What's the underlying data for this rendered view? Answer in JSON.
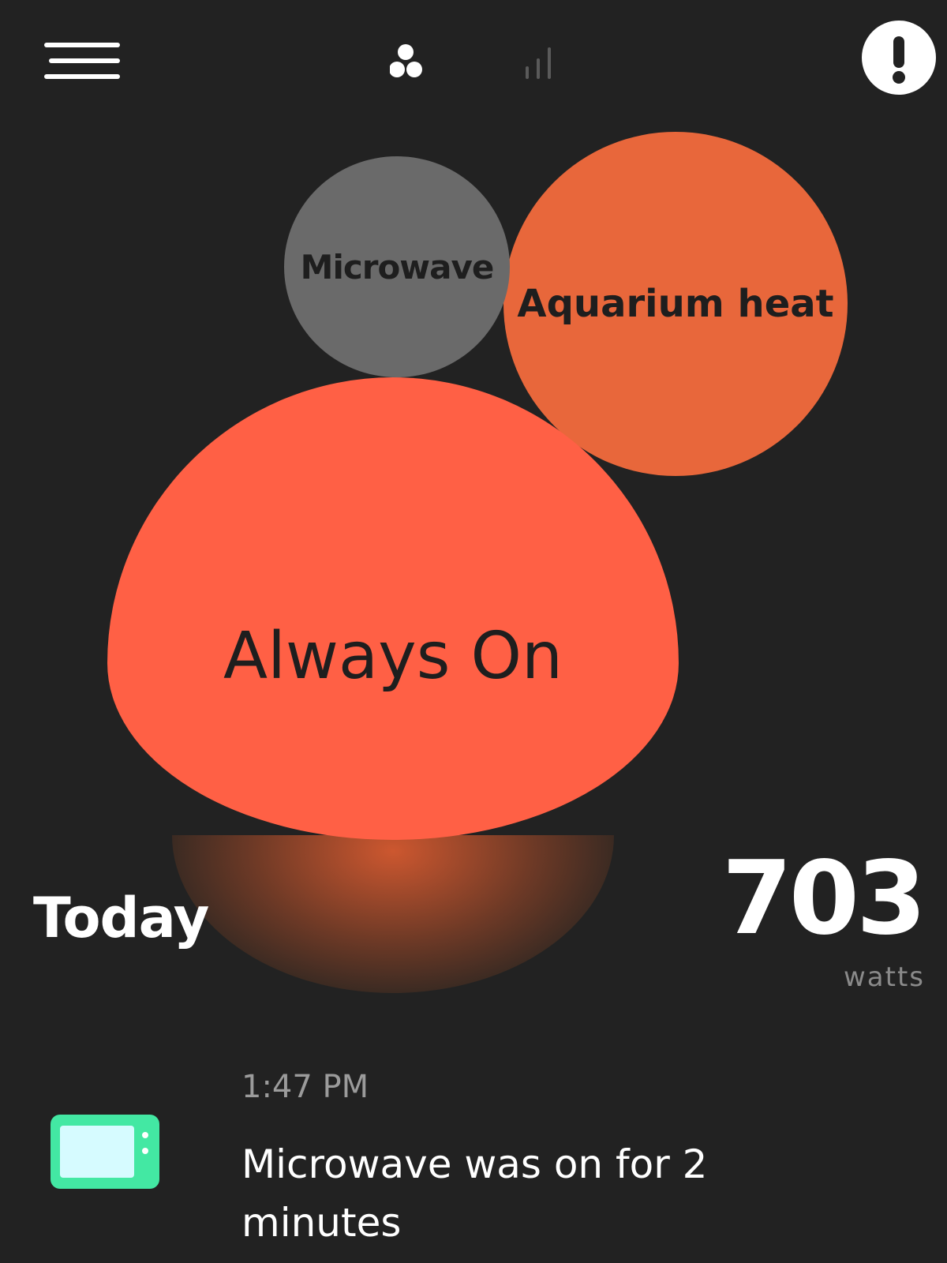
{
  "header": {
    "menu_icon": "hamburger-menu-icon",
    "tabs": [
      {
        "name": "bubbles",
        "icon": "bubbles-icon",
        "active": true
      },
      {
        "name": "bars",
        "icon": "bar-chart-icon",
        "active": false
      }
    ],
    "alert_icon": "exclamation-icon"
  },
  "bubbles": [
    {
      "label": "Microwave",
      "color": "#6a6a6a"
    },
    {
      "label": "Aquarium heat",
      "color": "#e8673b"
    },
    {
      "label": "Always On",
      "color": "#ff6045"
    }
  ],
  "summary": {
    "period": "Today",
    "value": "703",
    "unit": "watts"
  },
  "event": {
    "time": "1:47 PM",
    "icon": "microwave-icon",
    "icon_color": "#43e8a3",
    "text": "Microwave was on for 2 minutes"
  }
}
